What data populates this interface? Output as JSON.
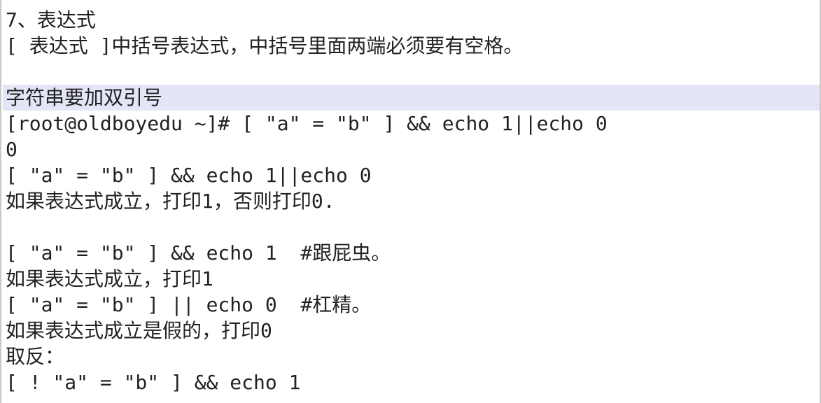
{
  "document": {
    "lines": [
      "7、表达式",
      "[ 表达式 ]中括号表达式，中括号里面两端必须要有空格。",
      "",
      "字符串要加双引号",
      "[root@oldboyedu ~]# [ \"a\" = \"b\" ] && echo 1||echo 0",
      "0",
      "[ \"a\" = \"b\" ] && echo 1||echo 0",
      "如果表达式成立，打印1，否则打印0.",
      "",
      "[ \"a\" = \"b\" ] && echo 1  #跟屁虫。",
      "如果表达式成立，打印1",
      "[ \"a\" = \"b\" ] || echo 0  #杠精。",
      "如果表达式成立是假的，打印0",
      "取反：",
      "[ ! \"a\" = \"b\" ] && echo 1"
    ],
    "highlight_color": "#e4e6f7"
  }
}
